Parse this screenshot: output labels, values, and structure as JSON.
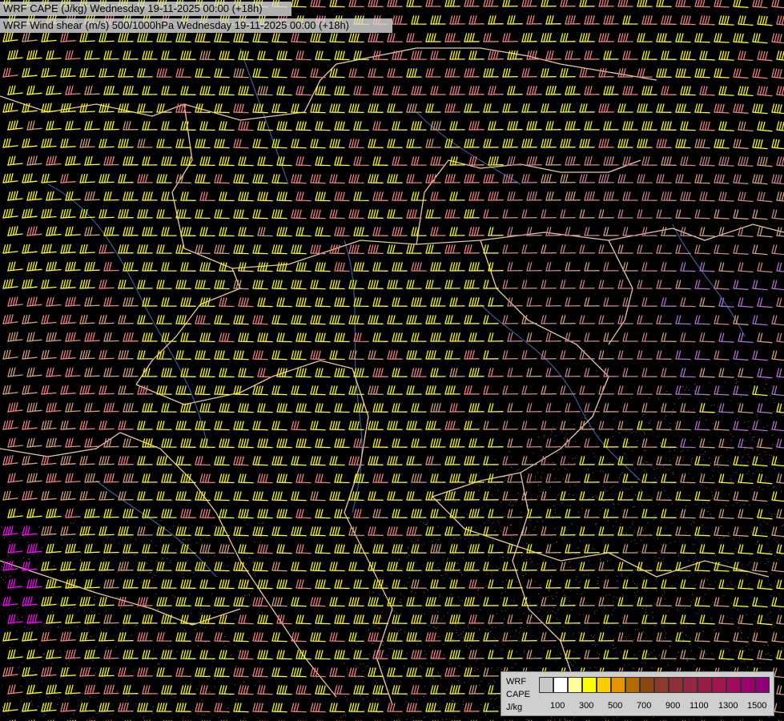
{
  "titles": {
    "line1": "WRF CAPE (J/kg) Wednesday 19-11-2025 00:00 (+18h)",
    "line2": "WRF Wind shear (m/s) 500/1000hPa Wednesday 19-11-2025 00:00 (+18h)"
  },
  "legend": {
    "label_line1": "WRF",
    "label_line2": "CAPE",
    "label_line3": "J/kg",
    "colors": [
      "#c8c8c8",
      "#ffffff",
      "#ffff99",
      "#ffff00",
      "#ffcc00",
      "#e69500",
      "#b36b00",
      "#8b4513",
      "#8b3a2a",
      "#8e2f3a",
      "#94263f",
      "#9a1d47",
      "#a0144f",
      "#a10a5e",
      "#9b006b",
      "#8d0076"
    ],
    "ticks": [
      "100",
      "300",
      "500",
      "700",
      "900",
      "1100",
      "1300",
      "1500"
    ]
  },
  "barb_colors": {
    "yellow": "#ffff00",
    "salmon": "#f08080",
    "tan": "#d2a07a",
    "magenta": "#ff00ff",
    "rosy": "#c8828c",
    "purple": "#b070d0"
  },
  "map_colors": {
    "background": "#000000",
    "border": "#e8c8a0",
    "river": "#3a5a9a",
    "stipple": "#8a6a4a"
  }
}
